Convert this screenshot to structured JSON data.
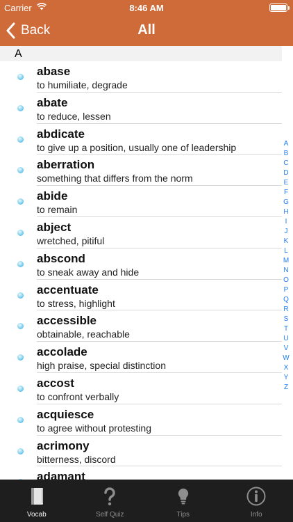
{
  "status_bar": {
    "carrier": "Carrier",
    "time": "8:46 AM"
  },
  "nav": {
    "back_label": "Back",
    "title": "All"
  },
  "section": {
    "letter": "A"
  },
  "entries": [
    {
      "word": "abase",
      "definition": "to humiliate, degrade"
    },
    {
      "word": "abate",
      "definition": "to reduce, lessen"
    },
    {
      "word": "abdicate",
      "definition": "to give up a position, usually one of leadership"
    },
    {
      "word": "aberration",
      "definition": "something that differs from the norm"
    },
    {
      "word": "abide",
      "definition": "to remain"
    },
    {
      "word": "abject",
      "definition": "wretched, pitiful"
    },
    {
      "word": "abscond",
      "definition": "to sneak away and hide"
    },
    {
      "word": "accentuate",
      "definition": "to stress, highlight"
    },
    {
      "word": "accessible",
      "definition": "obtainable, reachable"
    },
    {
      "word": "accolade",
      "definition": "high praise, special distinction"
    },
    {
      "word": "accost",
      "definition": "to confront verbally"
    },
    {
      "word": "acquiesce",
      "definition": "to agree without protesting"
    },
    {
      "word": "acrimony",
      "definition": "bitterness, discord"
    },
    {
      "word": "adamant",
      "definition": ""
    }
  ],
  "index_letters": [
    "A",
    "B",
    "C",
    "D",
    "E",
    "F",
    "G",
    "H",
    "I",
    "J",
    "K",
    "L",
    "M",
    "N",
    "O",
    "P",
    "Q",
    "R",
    "S",
    "T",
    "U",
    "V",
    "W",
    "X",
    "Y",
    "Z"
  ],
  "tabs": [
    {
      "label": "Vocab",
      "icon": "book-icon",
      "active": true
    },
    {
      "label": "Self Quiz",
      "icon": "question-icon",
      "active": false
    },
    {
      "label": "Tips",
      "icon": "lightbulb-icon",
      "active": false
    },
    {
      "label": "Info",
      "icon": "info-icon",
      "active": false
    }
  ],
  "colors": {
    "header": "#cf6a39",
    "tabbar": "#1e1e1e",
    "index": "#1e7cf2",
    "dot": "#5bbde6"
  }
}
